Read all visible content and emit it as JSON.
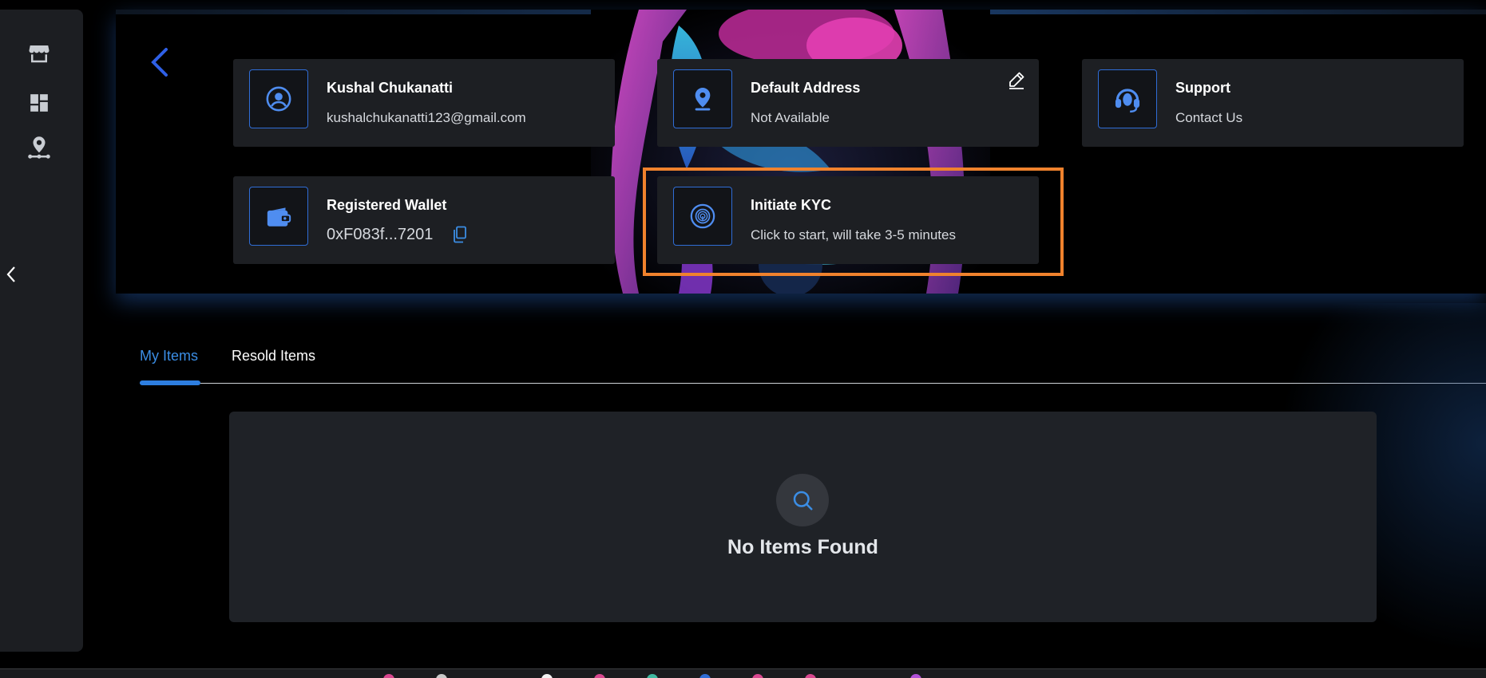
{
  "profile": {
    "name": "Kushal Chukanatti",
    "email": "kushalchukanatti123@gmail.com"
  },
  "address": {
    "title": "Default Address",
    "value": "Not Available"
  },
  "support": {
    "title": "Support",
    "value": "Contact Us"
  },
  "wallet": {
    "title": "Registered Wallet",
    "address": "0xF083f...7201"
  },
  "kyc": {
    "title": "Initiate KYC",
    "subtitle": "Click to start, will take 3-5 minutes"
  },
  "tabs": [
    {
      "label": "My Items",
      "active": true
    },
    {
      "label": "Resold Items",
      "active": false
    }
  ],
  "empty_state": {
    "message": "No Items Found"
  },
  "icons": {
    "rail": [
      "store-icon",
      "dashboard-icon",
      "location-network-icon"
    ],
    "back": "back-arrow-icon",
    "collapse": "chevron-left-icon"
  },
  "colors": {
    "accent": "#2d7ee0",
    "highlight": "#f0822d",
    "card_bg": "#1d1f23"
  }
}
